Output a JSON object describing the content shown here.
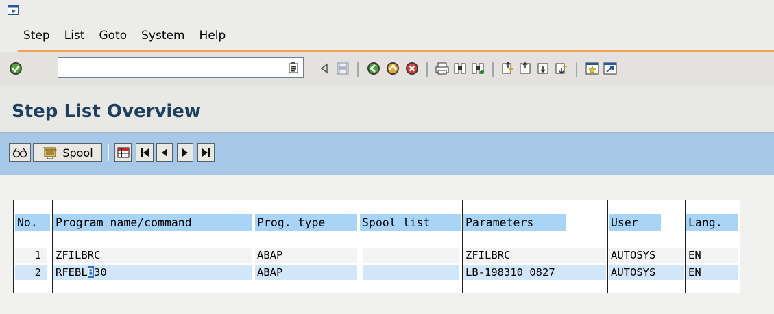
{
  "menu": [
    {
      "label": "Step",
      "ul": 1
    },
    {
      "label": "List",
      "ul": 0
    },
    {
      "label": "Goto",
      "ul": 0
    },
    {
      "label": "System",
      "ul": 2
    },
    {
      "label": "Help",
      "ul": 0
    }
  ],
  "command_field": {
    "value": ""
  },
  "page_title": "Step List Overview",
  "app_toolbar": {
    "spool_label": "Spool"
  },
  "table": {
    "headers": [
      "No.",
      "Program name/command",
      "Prog. type",
      "Spool list",
      "Parameters",
      "User",
      "Lang."
    ],
    "rows": [
      {
        "no": "1",
        "program": "ZFILBRC",
        "type": "ABAP",
        "spool": "",
        "params": "ZFILBRC",
        "user": "AUTOSYS",
        "lang": "EN"
      },
      {
        "no": "2",
        "program_pre": "RFEBL",
        "program_cursor": "B",
        "program_post": "30",
        "type": "ABAP",
        "spool": "",
        "params": "LB-198310_0827",
        "user": "AUTOSYS",
        "lang": "EN"
      }
    ]
  },
  "colors": {
    "menu_accent": "#f4a24d",
    "title_text": "#1e3f5f",
    "app_toolbar_bg": "#a7c8e6",
    "header_cell_bg": "#a7d4f7",
    "selected_row_bg": "#d1e6f8"
  },
  "icons": [
    "window-icon",
    "enter-icon",
    "history-icon",
    "back-arrow-icon",
    "save-icon",
    "back-icon",
    "exit-icon",
    "cancel-icon",
    "print-icon",
    "find-icon",
    "find-next-icon",
    "first-page-icon",
    "previous-page-icon",
    "next-page-icon",
    "last-page-icon",
    "new-session-icon",
    "shortcut-icon",
    "display-icon",
    "spool-icon",
    "layout-icon"
  ]
}
